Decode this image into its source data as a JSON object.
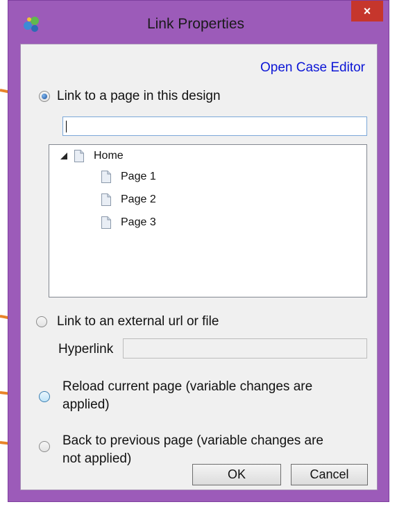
{
  "window": {
    "title": "Link Properties",
    "close_label": "×",
    "app_icon": "app-icon"
  },
  "header": {
    "case_editor_link": "Open Case Editor"
  },
  "options": {
    "page_link_label": "Link to a page in this design",
    "page_link_search_value": "",
    "external_label": "Link to an external url or file",
    "hyperlink_label": "Hyperlink",
    "hyperlink_value": "",
    "reload_label_line1": "Reload current page (variable changes are",
    "reload_label_line2": "applied)",
    "back_label_line1": "Back to previous page (variable changes are",
    "back_label_line2": "not applied)"
  },
  "tree": {
    "root": "Home",
    "children": [
      "Page 1",
      "Page 2",
      "Page 3"
    ]
  },
  "buttons": {
    "ok": "OK",
    "cancel": "Cancel"
  },
  "colors": {
    "window_frame": "#9c5bb9",
    "close_button": "#c6362c",
    "link": "#0c16d6",
    "annotation": "#e8832a"
  }
}
